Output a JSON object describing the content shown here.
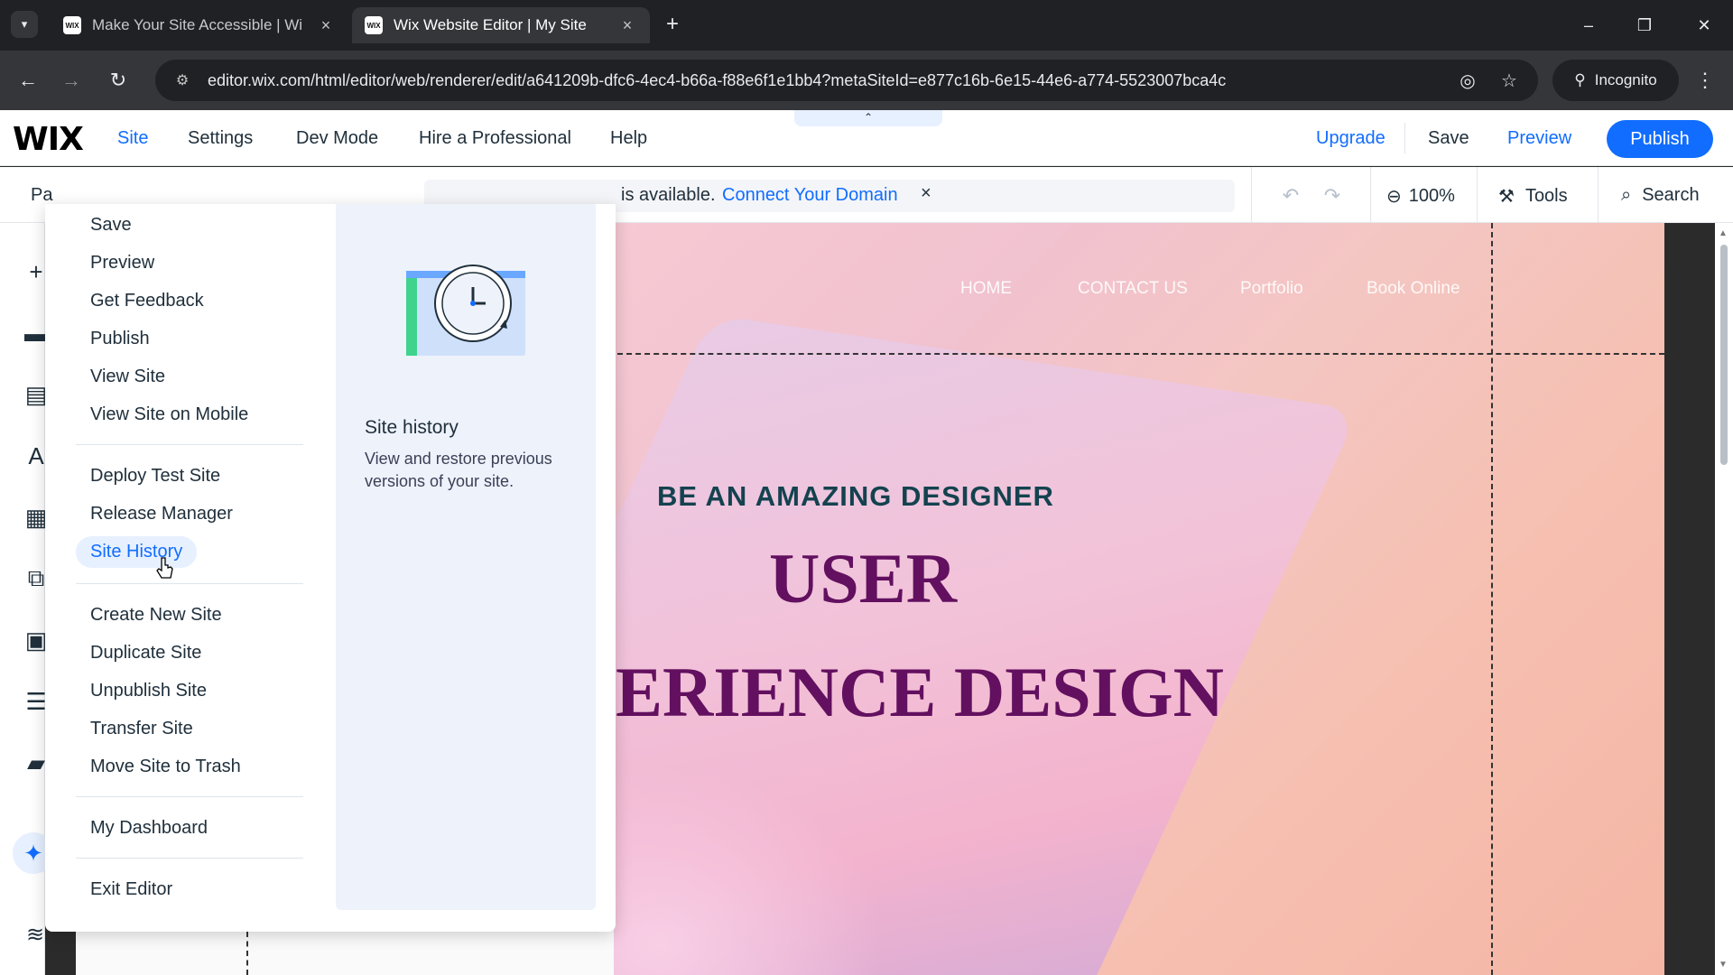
{
  "browser": {
    "tabs": [
      {
        "title": "Make Your Site Accessible | Wi",
        "favicon": "WIX"
      },
      {
        "title": "Wix Website Editor | My Site",
        "favicon": "WIX"
      }
    ],
    "url": "editor.wix.com/html/editor/web/renderer/edit/a641209b-dfc6-4ec4-b66a-f88e6f1e1bb4?metaSiteId=e877c16b-6e15-44e6-a774-5523007bca4c",
    "incognito_label": "Incognito",
    "icons": {
      "tab_search": "▾",
      "close": "×",
      "new_tab": "+",
      "minimize": "–",
      "restore": "❐",
      "window_close": "✕",
      "back": "←",
      "forward": "→",
      "reload": "↻",
      "site_info": "⚙",
      "eye_off": "◎",
      "star": "☆",
      "incognito": "⚲",
      "kebab": "⋮"
    }
  },
  "wix": {
    "logo": "WIX",
    "nav": [
      "Site",
      "Settings",
      "Dev Mode",
      "Hire a Professional",
      "Help"
    ],
    "active_nav": "Site",
    "collapse_handle": "⌃",
    "upgrade": "Upgrade",
    "save": "Save",
    "preview": "Preview",
    "publish": "Publish",
    "accent": "#116dff"
  },
  "toolbar": {
    "page_label": "Pa",
    "notice_text": "is available.",
    "notice_link": "Connect Your Domain",
    "notice_close": "×",
    "undo": "↶",
    "redo": "↷",
    "zoom_icon": "⊖",
    "zoom": "100%",
    "tools_icon": "⚒",
    "tools": "Tools",
    "search_icon": "⌕",
    "search": "Search"
  },
  "rail": {
    "icons": [
      "+",
      "▬",
      "▤",
      "A",
      "▦",
      "⧉",
      "▣",
      "☰",
      "▰"
    ],
    "ai": "✦",
    "layers": "≋"
  },
  "site_menu": {
    "group1": [
      "Save",
      "Preview",
      "Get Feedback",
      "Publish",
      "View Site",
      "View Site on Mobile"
    ],
    "group2": [
      "Deploy Test Site",
      "Release Manager",
      "Site History"
    ],
    "group3": [
      "Create New Site",
      "Duplicate Site",
      "Unpublish Site",
      "Transfer Site",
      "Move Site to Trash"
    ],
    "group4": [
      "My Dashboard"
    ],
    "group5": [
      "Exit Editor"
    ],
    "hovered": "Site History",
    "preview_title": "Site history",
    "preview_desc": "View and restore previous versions of your site."
  },
  "site_preview": {
    "nav": [
      "HOME",
      "CONTACT US",
      "Portfolio",
      "Book Online"
    ],
    "tagline": "BE AN AMAZING DESIGNER",
    "hero_line1": "USER",
    "hero_line2": "ERIENCE DESIGN"
  }
}
